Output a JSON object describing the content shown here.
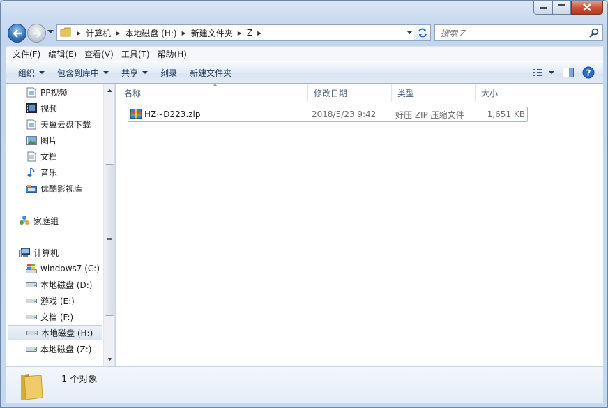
{
  "window": {
    "caption_buttons": [
      "minimize",
      "maximize",
      "close"
    ]
  },
  "navigation": {
    "breadcrumbs": [
      "计算机",
      "本地磁盘 (H:)",
      "新建文件夹",
      "Z"
    ],
    "search_placeholder": "搜索 Z"
  },
  "menubar": {
    "items": [
      "文件(F)",
      "编辑(E)",
      "查看(V)",
      "工具(T)",
      "帮助(H)"
    ]
  },
  "commandbar": {
    "organize": "组织",
    "include_in_library": "包含到库中",
    "share": "共享",
    "burn": "刻录",
    "new_folder": "新建文件夹"
  },
  "navpane": {
    "items": [
      {
        "label": "PP视频",
        "icon": "doc-icon"
      },
      {
        "label": "视频",
        "icon": "video-icon"
      },
      {
        "label": "天翼云盘下载",
        "icon": "doc-icon"
      },
      {
        "label": "图片",
        "icon": "picture-icon"
      },
      {
        "label": "文档",
        "icon": "document-icon"
      },
      {
        "label": "音乐",
        "icon": "music-icon"
      },
      {
        "label": "优酷影视库",
        "icon": "youku-icon"
      },
      {
        "label": "家庭组",
        "icon": "homegroup-icon"
      },
      {
        "label": "计算机",
        "icon": "computer-icon"
      },
      {
        "label": "windows7 (C:)",
        "icon": "system-drive-icon"
      },
      {
        "label": "本地磁盘 (D:)",
        "icon": "drive-icon"
      },
      {
        "label": "游戏 (E:)",
        "icon": "drive-icon"
      },
      {
        "label": "文档 (F:)",
        "icon": "drive-icon"
      },
      {
        "label": "本地磁盘 (H:)",
        "icon": "drive-icon",
        "selected": true
      },
      {
        "label": "本地磁盘 (Z:)",
        "icon": "drive-icon"
      }
    ]
  },
  "filelist": {
    "columns": {
      "name": "名称",
      "date": "修改日期",
      "type": "类型",
      "size": "大小"
    },
    "rows": [
      {
        "name": "HZ~D223.zip",
        "date": "2018/5/23 9:42",
        "type": "好压 ZIP 压缩文件",
        "size": "1,651 KB",
        "icon": "zip-archive-icon"
      }
    ]
  },
  "details": {
    "count": "1 个对象"
  },
  "colors": {
    "accent": "#3a6fb0",
    "selection": "#dbe4ef"
  }
}
